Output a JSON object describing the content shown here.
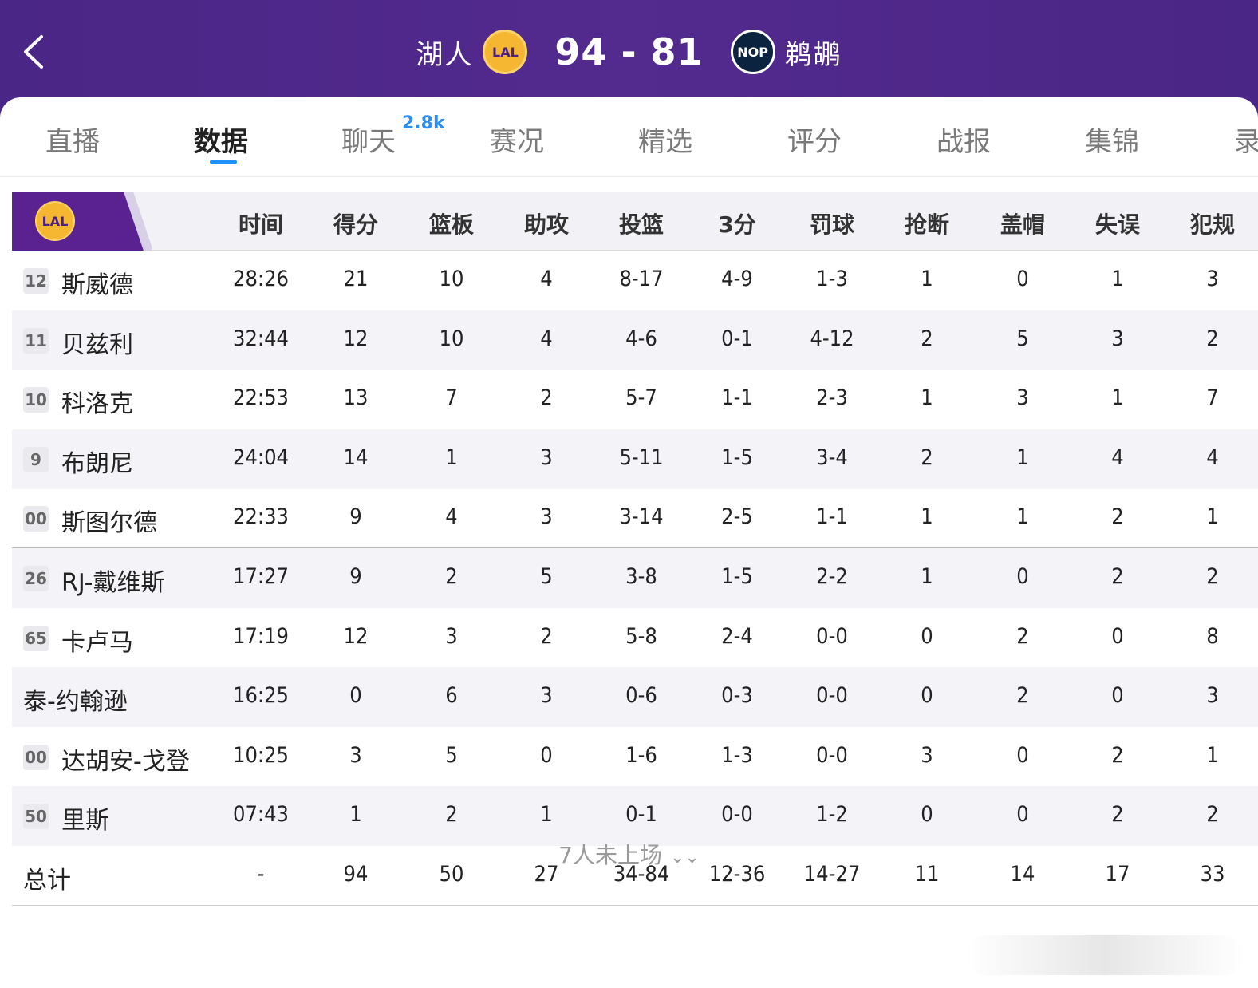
{
  "header": {
    "home_team": "湖人",
    "home_logo": "LAL",
    "score": "94 - 81",
    "away_logo": "NOP",
    "away_team": "鹈鹕"
  },
  "tabs": [
    {
      "label": "直播"
    },
    {
      "label": "数据"
    },
    {
      "label": "聊天",
      "badge": "2.8k"
    },
    {
      "label": "赛况"
    },
    {
      "label": "精选"
    },
    {
      "label": "评分"
    },
    {
      "label": "战报"
    },
    {
      "label": "集锦"
    },
    {
      "label": "录"
    }
  ],
  "table": {
    "team_logo": "LAL",
    "columns": [
      "时间",
      "得分",
      "篮板",
      "助攻",
      "投篮",
      "3分",
      "罚球",
      "抢断",
      "盖帽",
      "失误",
      "犯规"
    ],
    "rows": [
      {
        "num": "12",
        "name": "斯威德",
        "stats": [
          "28:26",
          "21",
          "10",
          "4",
          "8-17",
          "4-9",
          "1-3",
          "1",
          "0",
          "1",
          "3"
        ]
      },
      {
        "num": "11",
        "name": "贝兹利",
        "stats": [
          "32:44",
          "12",
          "10",
          "4",
          "4-6",
          "0-1",
          "4-12",
          "2",
          "5",
          "3",
          "2"
        ]
      },
      {
        "num": "10",
        "name": "科洛克",
        "stats": [
          "22:53",
          "13",
          "7",
          "2",
          "5-7",
          "1-1",
          "2-3",
          "1",
          "3",
          "1",
          "7"
        ]
      },
      {
        "num": "9",
        "name": "布朗尼",
        "stats": [
          "24:04",
          "14",
          "1",
          "3",
          "5-11",
          "1-5",
          "3-4",
          "2",
          "1",
          "4",
          "4"
        ]
      },
      {
        "num": "00",
        "name": "斯图尔德",
        "stats": [
          "22:33",
          "9",
          "4",
          "3",
          "3-14",
          "2-5",
          "1-1",
          "1",
          "1",
          "2",
          "1"
        ]
      },
      {
        "num": "26",
        "name": "RJ-戴维斯",
        "stats": [
          "17:27",
          "9",
          "2",
          "5",
          "3-8",
          "1-5",
          "2-2",
          "1",
          "0",
          "2",
          "2"
        ]
      },
      {
        "num": "65",
        "name": "卡卢马",
        "stats": [
          "17:19",
          "12",
          "3",
          "2",
          "5-8",
          "2-4",
          "0-0",
          "0",
          "2",
          "0",
          "8"
        ]
      },
      {
        "num": "",
        "name": "泰-约翰逊",
        "stats": [
          "16:25",
          "0",
          "6",
          "3",
          "0-6",
          "0-3",
          "0-0",
          "0",
          "2",
          "0",
          "3"
        ]
      },
      {
        "num": "00",
        "name": "达胡安-戈登",
        "stats": [
          "10:25",
          "3",
          "5",
          "0",
          "1-6",
          "1-3",
          "0-0",
          "3",
          "0",
          "2",
          "1"
        ]
      },
      {
        "num": "50",
        "name": "里斯",
        "stats": [
          "07:43",
          "1",
          "2",
          "1",
          "0-1",
          "0-0",
          "1-2",
          "0",
          "0",
          "2",
          "2"
        ]
      }
    ],
    "totals": {
      "label": "总计",
      "stats": [
        "-",
        "94",
        "50",
        "27",
        "34-84",
        "12-36",
        "14-27",
        "11",
        "14",
        "17",
        "33"
      ]
    }
  },
  "footer": {
    "more_label": "7人未上场"
  },
  "colors": {
    "header_purple": "#4a2686",
    "lakers_gold": "#f5b731",
    "accent_blue": "#1e90ff"
  }
}
